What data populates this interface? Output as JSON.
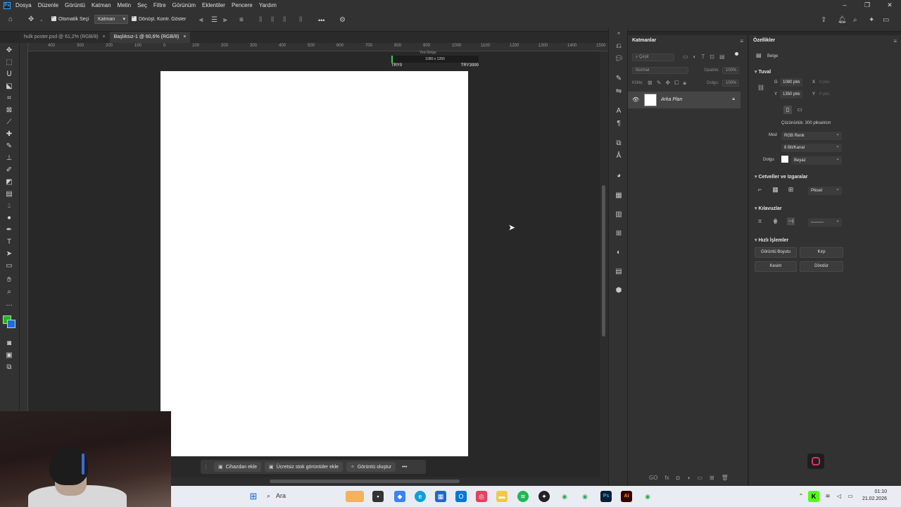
{
  "menu": {
    "logo": "Ps",
    "items": [
      "Dosya",
      "Düzenle",
      "Görüntü",
      "Katman",
      "Metin",
      "Seç",
      "Filtre",
      "Görünüm",
      "Eklentiler",
      "Pencere",
      "Yardım"
    ]
  },
  "window_controls": {
    "minimize": "–",
    "restore": "❐",
    "close": "✕"
  },
  "options_bar": {
    "auto_select_label": "Otomatik Seçi",
    "auto_select_target": "Katman",
    "transform_controls_label": "Dönüşt. Kontr. Göster",
    "more": "•••"
  },
  "tabs": [
    {
      "label": "hulk poster.psd @ 61,2% (RGB/8)",
      "close": "×",
      "active": false
    },
    {
      "label": "Başlıksız-1 @ 60,6% (RGB/8)",
      "close": "×",
      "active": true
    }
  ],
  "ruler_ticks": [
    "400",
    "300",
    "200",
    "100",
    "0",
    "100",
    "200",
    "300",
    "400",
    "500",
    "600",
    "700",
    "800",
    "900",
    "1000",
    "1100",
    "1200",
    "1300",
    "1400",
    "1500"
  ],
  "progress_overlay": {
    "top_text": "Yeni Belge",
    "middle_text": "1080 x 1350",
    "left_label": "TRY0",
    "right_label": "TRY3000",
    "fill_fraction": 0.02
  },
  "context_bar": {
    "add_from_device": "Cihazdan ekle",
    "add_free_stock": "Ücretsiz stok görüntüler ekle",
    "generate_image": "Görüntü oluştur",
    "more": "•••"
  },
  "layers_panel": {
    "title": "Katmanlar",
    "search_placeholder": "Çeşit",
    "blend_mode": "Normal",
    "opacity_label": "Opaklık:",
    "opacity_value": "100%",
    "lock_label": "Kilitle:",
    "fill_label": "Dolgu:",
    "fill_value": "100%",
    "layer_name": "Arka Plan",
    "footer_icons": [
      "GO",
      "fx",
      "◘",
      "◑",
      "▭",
      "⊞",
      "🗑"
    ]
  },
  "properties_panel": {
    "title": "Özellikler",
    "doc_label": "Belge",
    "canvas_section": "Tuval",
    "width_label": "G",
    "width_value": "1080 pks",
    "height_label": "Y",
    "height_value": "1350 pks",
    "x_label": "X",
    "x_value": "0 pks",
    "y_label": "Y",
    "y_value": "0 pks",
    "resolution": "Çözünürlük: 300 piksel/cm",
    "mode_label": "Mod",
    "mode_value": "RGB Renk",
    "bitdepth_value": "8 Bit/Kanal",
    "fill_label": "Dolgu",
    "fill_value": "Beyaz",
    "rulers_section": "Cetveller ve Izgaralar",
    "units_value": "Piksel",
    "guides_section": "Kılavuzlar",
    "quick_actions_section": "Hızlı İşlemler",
    "btn_image_size": "Görüntü Boyutu",
    "btn_crop": "Kırp",
    "btn_trim": "Kesim",
    "btn_rotate": "Döndür"
  },
  "taskbar": {
    "search_label": "Ara",
    "time": "01:10",
    "date": "21.02.2026"
  }
}
